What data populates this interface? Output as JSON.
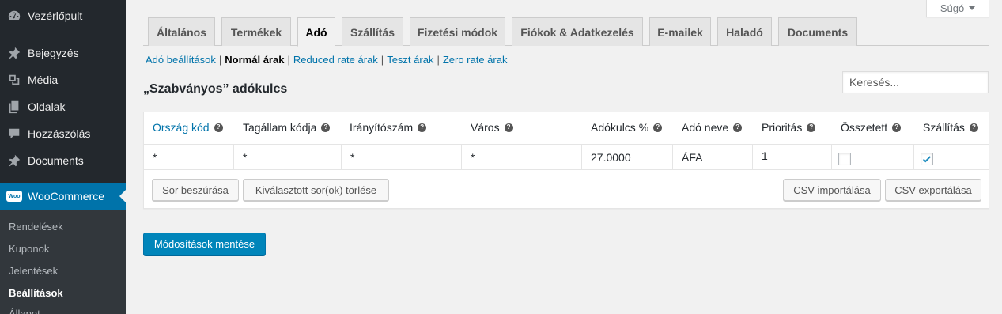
{
  "sidebar": {
    "items": [
      {
        "label": "Vezérlőpult",
        "icon": "dashboard-icon"
      },
      {
        "label": "Bejegyzés",
        "icon": "pin-icon"
      },
      {
        "label": "Média",
        "icon": "media-icon"
      },
      {
        "label": "Oldalak",
        "icon": "pages-icon"
      },
      {
        "label": "Hozzászólás",
        "icon": "comments-icon"
      },
      {
        "label": "Documents",
        "icon": "pin-icon"
      },
      {
        "label": "WooCommerce",
        "icon": "woocommerce-icon"
      }
    ],
    "woo_icon_text": "Woo",
    "submenu": [
      {
        "label": "Rendelések"
      },
      {
        "label": "Kuponok"
      },
      {
        "label": "Jelentések"
      },
      {
        "label": "Beállítások"
      },
      {
        "label": "Állapot"
      }
    ]
  },
  "help": {
    "label": "Súgó"
  },
  "tabs": [
    {
      "label": "Általános"
    },
    {
      "label": "Termékek"
    },
    {
      "label": "Adó"
    },
    {
      "label": "Szállítás"
    },
    {
      "label": "Fizetési módok"
    },
    {
      "label": "Fiókok & Adatkezelés"
    },
    {
      "label": "E-mailek"
    },
    {
      "label": "Haladó"
    },
    {
      "label": "Documents"
    }
  ],
  "active_tab": "Adó",
  "sections": [
    {
      "label": "Adó beállítások"
    },
    {
      "label": "Normál árak"
    },
    {
      "label": "Reduced rate árak"
    },
    {
      "label": "Teszt árak"
    },
    {
      "label": "Zero rate árak"
    }
  ],
  "section_separator": "|",
  "page": {
    "title": "„Szabványos” adókulcs"
  },
  "search": {
    "placeholder": "Keresés..."
  },
  "table": {
    "columns": [
      {
        "label": "Ország kód"
      },
      {
        "label": "Tagállam kódja"
      },
      {
        "label": "Irányítószám"
      },
      {
        "label": "Város"
      },
      {
        "label": "Adókulcs %"
      },
      {
        "label": "Adó neve"
      },
      {
        "label": "Prioritás"
      },
      {
        "label": "Összetett"
      },
      {
        "label": "Szállítás"
      }
    ],
    "help_glyph": "?",
    "rows": [
      {
        "country": "*",
        "state": "*",
        "postcode": "*",
        "city": "*",
        "rate": "27.0000",
        "name": "ÁFA",
        "priority": "1",
        "compound": false,
        "shipping": true
      }
    ],
    "buttons": {
      "insert_row": "Sor beszúrása",
      "remove_rows": "Kiválasztott sor(ok) törlése",
      "import_csv": "CSV importálása",
      "export_csv": "CSV exportálása"
    }
  },
  "save_button": {
    "label": "Módosítások mentése"
  },
  "colors": {
    "sidebar_bg": "#23282d",
    "submenu_bg": "#32373c",
    "accent": "#0073aa",
    "primary_button": "#0085ba",
    "page_bg": "#f1f1f1"
  }
}
